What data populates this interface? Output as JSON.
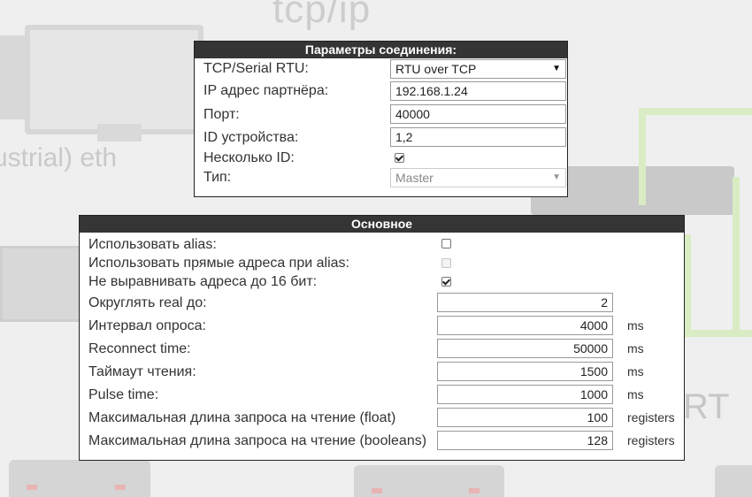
{
  "background": {
    "title_text": "tcp/ip",
    "side_text": "ustrial) eth",
    "corner_text": "RT"
  },
  "connection": {
    "title": "Параметры соединения:",
    "rows": [
      {
        "label": "TCP/Serial RTU:",
        "value": "RTU over TCP",
        "kind": "select"
      },
      {
        "label": "IP адрес партнёра:",
        "value": "192.168.1.24",
        "kind": "input"
      },
      {
        "label": "Порт:",
        "value": "40000",
        "kind": "input"
      },
      {
        "label": "ID устройства:",
        "value": "1,2",
        "kind": "input"
      },
      {
        "label": "Несколько ID:",
        "checked": true,
        "kind": "checkbox"
      },
      {
        "label": "Тип:",
        "value": "Master",
        "kind": "select-disabled"
      }
    ]
  },
  "main": {
    "title": "Основное",
    "checkboxes": [
      {
        "label": "Использовать alias:",
        "checked": false,
        "disabled": false
      },
      {
        "label": "Использовать прямые адреса при alias:",
        "checked": false,
        "disabled": true
      },
      {
        "label": "Не выравнивать адреса до 16 бит:",
        "checked": true,
        "disabled": false
      }
    ],
    "fields": [
      {
        "label": "Округлять real до:",
        "value": "2",
        "unit": ""
      },
      {
        "label": "Интервал опроса:",
        "value": "4000",
        "unit": "ms"
      },
      {
        "label": "Reconnect time:",
        "value": "50000",
        "unit": "ms"
      },
      {
        "label": "Таймаут чтения:",
        "value": "1500",
        "unit": "ms"
      },
      {
        "label": "Pulse time:",
        "value": "1000",
        "unit": "ms"
      },
      {
        "label": "Максимальная длина запроса на чтение (float)",
        "value": "100",
        "unit": "registers"
      },
      {
        "label": "Максимальная длина запроса на чтение (booleans)",
        "value": "128",
        "unit": "registers"
      }
    ]
  },
  "icons": {
    "dropdown": "caret-down-icon",
    "checkbox": "checkbox-icon"
  }
}
